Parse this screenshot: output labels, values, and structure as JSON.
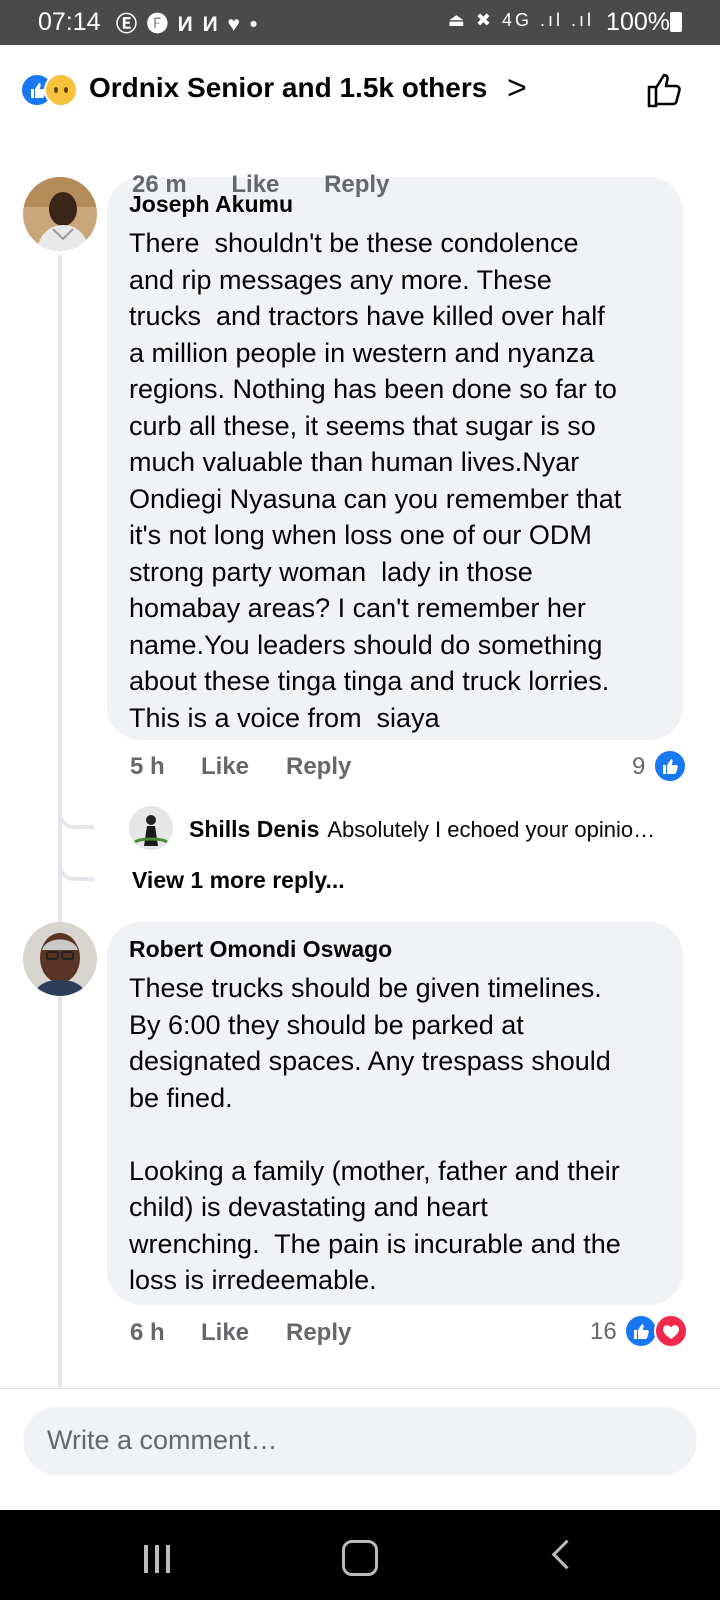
{
  "status_bar": {
    "time": "07:14",
    "app_icons": "Ⓔ 🅕 И И ♥ •",
    "signal_icons": "⏏ ✖ 4G .ıl .ıl",
    "battery": "100%"
  },
  "header": {
    "reactions_text": "Ordnix Senior and 1.5k others",
    "chevron": ">",
    "like_icon": "thumbs-up-outline-icon"
  },
  "scrolled_row": {
    "time": "26 m",
    "like": "Like",
    "reply": "Reply"
  },
  "comments": [
    {
      "author": "Joseph Akumu",
      "text": "There  shouldn't be these condolence\nand rip messages any more. These\ntrucks  and tractors have killed over half\na million people in western and nyanza\nregions. Nothing has been done so far to\ncurb all these, it seems that sugar is so\nmuch valuable than human lives.Nyar\nOndiegi Nyasuna can you remember that\nit's not long when loss one of our ODM\nstrong party woman  lady in those\nhomabay areas? I can't remember her\nname.You leaders should do something\nabout these tinga tinga and truck lorries.\nThis is a voice from  siaya",
      "time": "5 h",
      "like": "Like",
      "reply": "Reply",
      "reaction_count": "9",
      "reply_preview": {
        "author": "Shills Denis",
        "snippet": "Absolutely I echoed your opinio…"
      },
      "view_more": "View 1 more reply..."
    },
    {
      "author": "Robert Omondi Oswago",
      "text": "These trucks should be given timelines.\nBy 6:00 they should be parked at\ndesignated spaces. Any trespass should\nbe fined.\n\nLooking a family (mother, father and their\nchild) is devastating and heart\nwrenching.  The pain is incurable and the\nloss is irredeemable.",
      "time": "6 h",
      "like": "Like",
      "reply": "Reply",
      "reaction_count": "16"
    }
  ],
  "composer": {
    "placeholder": "Write a comment…"
  },
  "colors": {
    "accent": "#1877f2",
    "love": "#f0284a",
    "bubble": "#f0f2f5",
    "meta": "#65676b"
  }
}
